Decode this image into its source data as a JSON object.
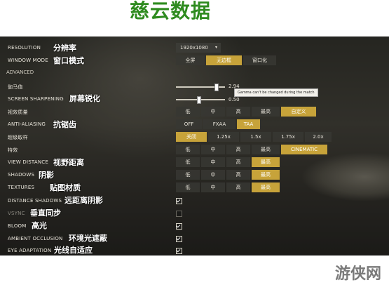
{
  "watermark": "慈云数据",
  "site_logo": "游侠网",
  "tooltip": "Gamma can't be changed during the match",
  "resolution": {
    "label": "RESOLUTION",
    "cn": "分辨率",
    "value": "1920x1080",
    "caret": "▾"
  },
  "window_mode": {
    "label": "WINDOW MODE",
    "cn": "窗口模式",
    "options": [
      "全屏",
      "无边框",
      "窗口化"
    ],
    "selected": 1
  },
  "advanced": "ADVANCED",
  "gamma": {
    "label": "伽马值",
    "value": "2.94",
    "fraction": 0.82
  },
  "sharpening": {
    "label": "SCREEN SHARPENING",
    "cn": "屏幕锐化",
    "value": "0.50",
    "fraction": 0.45
  },
  "visual_quality": {
    "label": "视效质量",
    "options": [
      "低",
      "中",
      "高",
      "最高",
      "自定义"
    ],
    "selected": 4
  },
  "anti_aliasing": {
    "label": "ANTI-ALIASING",
    "cn": "抗锯齿",
    "options": [
      "OFF",
      "FXAA",
      "TAA"
    ],
    "selected": 2
  },
  "supersampling": {
    "label": "超级取样",
    "options": [
      "关闭",
      "1.25x",
      "1.5x",
      "1.75x",
      "2.0x"
    ],
    "selected": 0
  },
  "effects": {
    "label": "特效",
    "options": [
      "低",
      "中",
      "高",
      "最高",
      "CINEMATIC"
    ],
    "selected": 4
  },
  "view_distance": {
    "label": "VIEW DISTANCE",
    "cn": "视野距离",
    "options": [
      "低",
      "中",
      "高",
      "最高"
    ],
    "selected": 3
  },
  "shadows": {
    "label": "SHADOWS",
    "cn": "阴影",
    "options": [
      "低",
      "中",
      "高",
      "最高"
    ],
    "selected": 3
  },
  "textures": {
    "label": "TEXTURES",
    "cn": "贴图材质",
    "options": [
      "低",
      "中",
      "高",
      "最高"
    ],
    "selected": 3
  },
  "checks": [
    {
      "label": "DISTANCE SHADOWS",
      "cn": "远距离阴影",
      "checked": true,
      "disabled": false
    },
    {
      "label": "VSYNC",
      "cn": "垂直同步",
      "checked": false,
      "disabled": true
    },
    {
      "label": "BLOOM",
      "cn": "高光",
      "checked": true,
      "disabled": false
    },
    {
      "label": "AMBIENT OCCLUSION",
      "cn": "环境光遮蔽",
      "checked": true,
      "disabled": false
    },
    {
      "label": "EYE ADAPTATION",
      "cn": "光线自适应",
      "checked": true,
      "disabled": false
    }
  ],
  "colors": {
    "accent": "#c7a33a",
    "watermark": "#2e8b1f"
  }
}
